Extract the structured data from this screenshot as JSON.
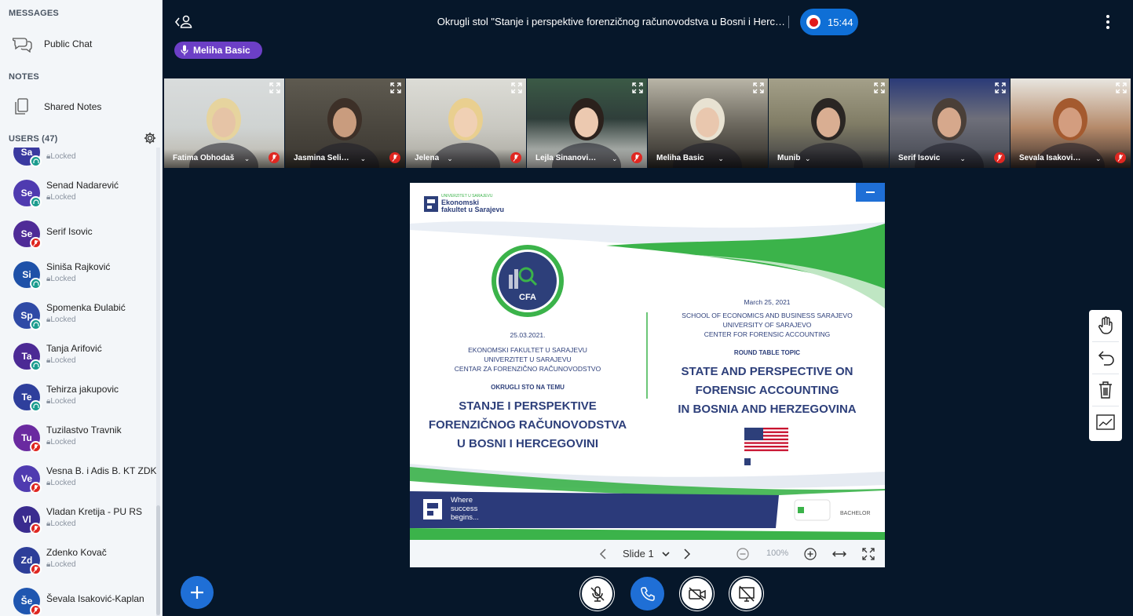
{
  "sidebar": {
    "messages_title": "MESSAGES",
    "public_chat": "Public Chat",
    "notes_title": "NOTES",
    "shared_notes": "Shared Notes",
    "users_title": "USERS (47)",
    "users": [
      {
        "initials": "Sa",
        "name": "",
        "state": "Locked",
        "status": "listen",
        "color": "#3a3aa0"
      },
      {
        "initials": "Se",
        "name": "Senad Nadarević",
        "state": "Locked",
        "status": "listen",
        "color": "#4f3bb0"
      },
      {
        "initials": "Se",
        "name": "Serif Isovic",
        "state": "",
        "status": "muted",
        "color": "#4f2b97"
      },
      {
        "initials": "Si",
        "name": "Siniša Rajković",
        "state": "Locked",
        "status": "listen",
        "color": "#1e51a8"
      },
      {
        "initials": "Sp",
        "name": "Spomenka Đulabić",
        "state": "Locked",
        "status": "listen",
        "color": "#2f4aa6"
      },
      {
        "initials": "Ta",
        "name": "Tanja Arifović",
        "state": "Locked",
        "status": "listen",
        "color": "#4c2a95"
      },
      {
        "initials": "Te",
        "name": "Tehirza jakupovic",
        "state": "Locked",
        "status": "listen",
        "color": "#2e3f9c"
      },
      {
        "initials": "Tu",
        "name": "Tuzilastvo Travnik",
        "state": "Locked",
        "status": "muted",
        "color": "#6a2aa0"
      },
      {
        "initials": "Ve",
        "name": "Vesna B. i Adis B. KT ZDK",
        "state": "Locked",
        "status": "muted",
        "color": "#4f3bb0"
      },
      {
        "initials": "Vl",
        "name": "Vladan Kretija - PU RS",
        "state": "Locked",
        "status": "muted",
        "color": "#3a2c8f"
      },
      {
        "initials": "Zd",
        "name": "Zdenko Kovač",
        "state": "Locked",
        "status": "muted",
        "color": "#2d3e99"
      },
      {
        "initials": "Še",
        "name": "Ševala Isaković-Kaplan",
        "state": "",
        "status": "muted",
        "color": "#1f56b0"
      }
    ]
  },
  "topbar": {
    "meeting_title": "Okrugli stol \"Stanje i perspektive forenzičnog računovodstva u Bosni i Herc…",
    "recording_time": "15:44",
    "talking_user": "Meliha Basic"
  },
  "videos": [
    {
      "name": "Fatima Obhodaš",
      "muted": true,
      "active": false
    },
    {
      "name": "Jasmina Seli…",
      "muted": true,
      "active": false
    },
    {
      "name": "Jelena",
      "muted": true,
      "active": false
    },
    {
      "name": "Lejla Sinanovi…",
      "muted": true,
      "active": false
    },
    {
      "name": "Meliha Basic",
      "muted": false,
      "active": true
    },
    {
      "name": "Munib",
      "muted": false,
      "active": false
    },
    {
      "name": "Serif Isovic",
      "muted": true,
      "active": false
    },
    {
      "name": "Ševala Isakovi…",
      "muted": true,
      "active": false
    }
  ],
  "slide": {
    "faculty_small": "UNIVERZITET U SARAJEVU",
    "faculty_name_1": "Ekonomski",
    "faculty_name_2": "fakultet u Sarajevu",
    "cfa": "CFA",
    "bs_date": "25.03.2021.",
    "bs_org_1": "EKONOMSKI FAKULTET U SARAJEVU",
    "bs_org_2": "UNIVERZITET U SARAJEVU",
    "bs_org_3": "CENTAR ZA FORENZIČNO RAČUNOVODSTVO",
    "bs_topic_label": "OKRUGLI STO NA TEMU",
    "bs_title_1": "STANJE I PERSPEKTIVE",
    "bs_title_2": "FORENZIČNOG RAČUNOVODSTVA",
    "bs_title_3": "U BOSNI I HERCEGOVINI",
    "en_date": "March 25, 2021",
    "en_org_1": "SCHOOL OF ECONOMICS AND BUSINESS SARAJEVO",
    "en_org_2": "UNIVERSITY OF SARAJEVO",
    "en_org_3": "CENTER FOR FORENSIC ACCOUNTING",
    "en_topic_label": "ROUND TABLE TOPIC",
    "en_title_1": "STATE AND PERSPECTIVE ON",
    "en_title_2": "FORENSIC ACCOUNTING",
    "en_title_3": "IN BOSNIA AND HERZEGOVINA",
    "slogan_1": "Where",
    "slogan_2": "success",
    "slogan_3": "begins...",
    "bachelor": "BACHELOR"
  },
  "slide_controls": {
    "slide_label": "Slide 1",
    "zoom": "100%"
  },
  "colors": {
    "background": "#06172a",
    "accent": "#1f6fd6",
    "talker": "#6c3fc6",
    "muted": "#df2721",
    "listen": "#1a9c8e",
    "slide_navy": "#2b3a7a",
    "slide_green": "#3bb34a"
  }
}
